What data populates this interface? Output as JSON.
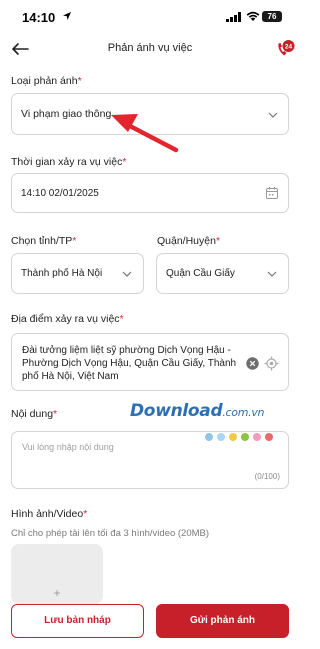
{
  "status_bar": {
    "time": "14:10",
    "battery": "76"
  },
  "header": {
    "title": "Phản ánh vụ việc",
    "hotline_badge": "24"
  },
  "form": {
    "type_label": "Loại phản ánh",
    "type_value": "Vi phạm giao thông",
    "time_label": "Thời gian xảy ra vụ việc",
    "time_value": "14:10 02/01/2025",
    "province_label": "Chọn tỉnh/TP",
    "province_value": "Thành phố Hà Nội",
    "district_label": "Quận/Huyện",
    "district_value": "Quận Cầu Giấy",
    "location_label": "Địa điểm xảy ra vụ việc",
    "location_value": "Đài tưởng liệm liệt sỹ phường Dịch Vọng Hậu - Phường Dịch Vọng Hậu, Quận Cầu Giấy, Thành phố Hà Nội, Việt Nam",
    "content_label": "Nội dung",
    "content_placeholder": "Vui lòng nhập nội dung",
    "content_counter": "(0/100)",
    "media_label": "Hình ảnh/Video",
    "media_hint": "Chỉ cho phép tải lên tối đa 3 hình/video (20MB)",
    "upload_plus": "+",
    "required_mark": "*"
  },
  "watermark": {
    "main": "Download",
    "sub": ".com.vn",
    "dot_colors": [
      "#8ec6e8",
      "#a9d7f2",
      "#f2c84b",
      "#8cc63f",
      "#f39bb8",
      "#e86a6a"
    ]
  },
  "buttons": {
    "draft": "Lưu bản nháp",
    "send": "Gửi phản ánh"
  },
  "colors": {
    "accent": "#c8202a",
    "required": "#d7262d",
    "border": "#d4d4d4"
  }
}
